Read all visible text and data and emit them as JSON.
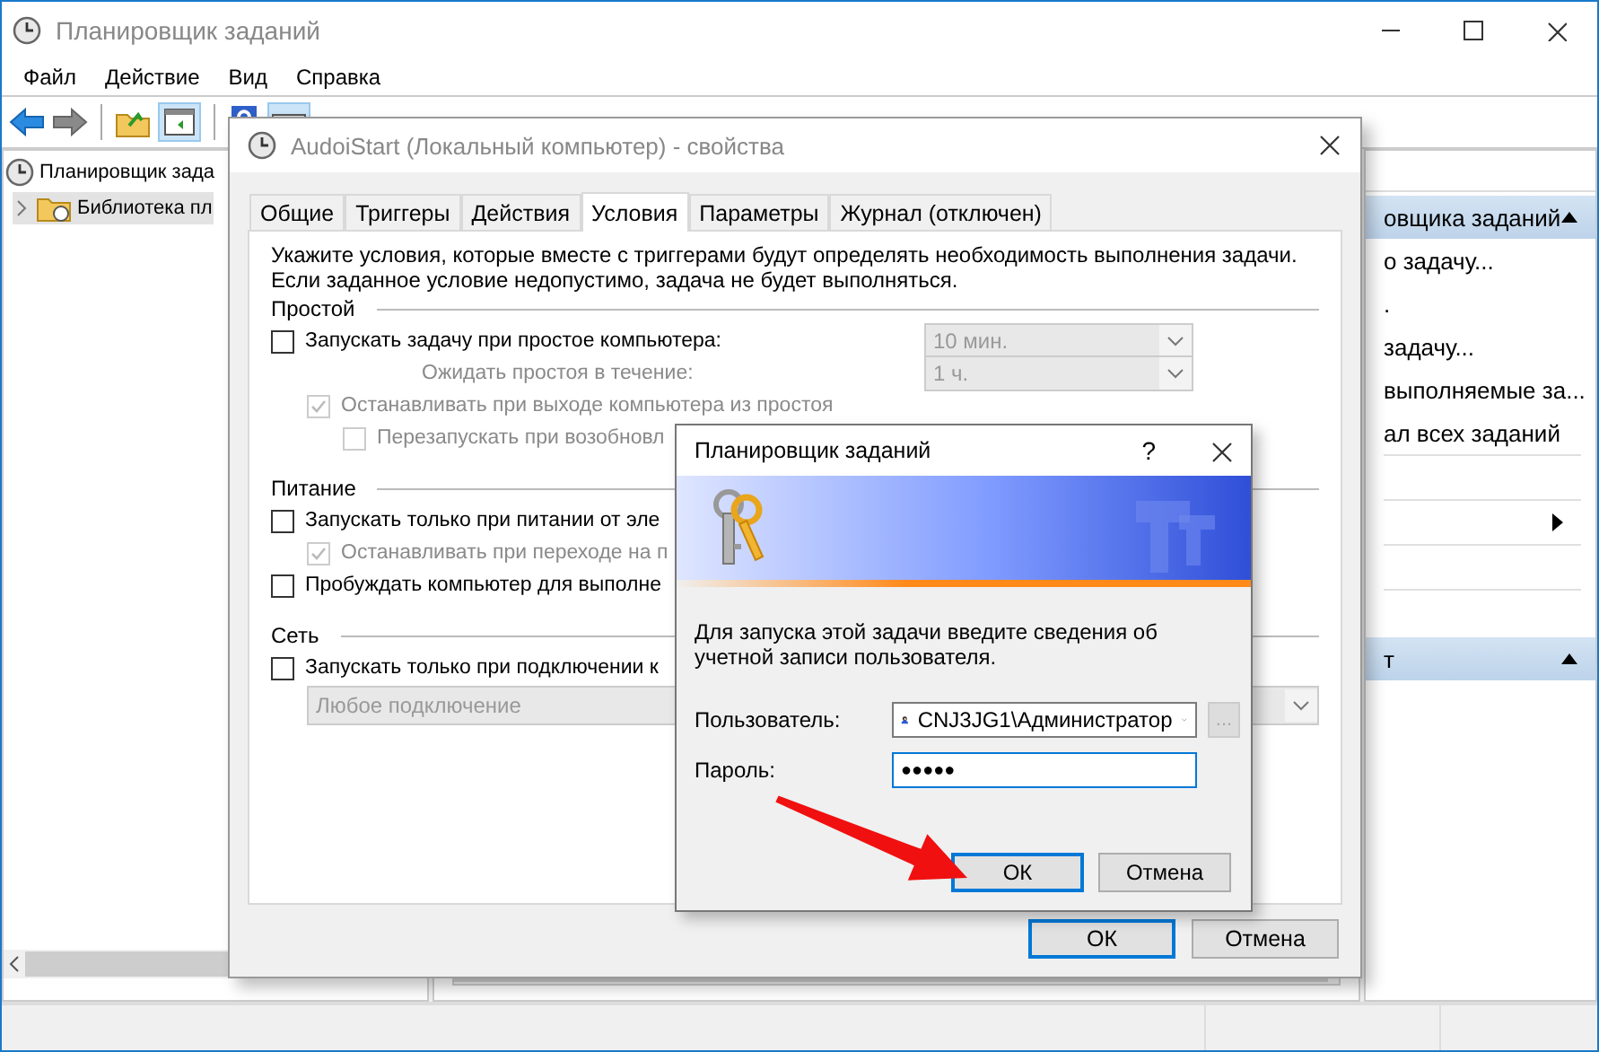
{
  "main_window": {
    "title": "Планировщик заданий",
    "menu": [
      "Файл",
      "Действие",
      "Вид",
      "Справка"
    ],
    "tree": [
      {
        "label": "Планировщик зада",
        "selected": false,
        "children": [
          {
            "label": "Библиотека пл",
            "selected": true,
            "expanded": false
          }
        ]
      }
    ],
    "actions_panel": {
      "sections": [
        {
          "title": "овщика заданий",
          "expanded": true,
          "items": [
            "о задачу...",
            ".",
            "задачу...",
            "выполняемые за...",
            "ал всех заданий"
          ]
        },
        {
          "title": "т",
          "expanded": true
        }
      ]
    }
  },
  "properties_dialog": {
    "title": "AudoiStart (Локальный компьютер) - свойства",
    "tabs": [
      {
        "label": "Общие",
        "selected": false
      },
      {
        "label": "Триггеры",
        "selected": false
      },
      {
        "label": "Действия",
        "selected": false
      },
      {
        "label": "Условия",
        "selected": true
      },
      {
        "label": "Параметры",
        "selected": false
      },
      {
        "label": "Журнал (отключен)",
        "selected": false
      }
    ],
    "intro": [
      "Укажите условия, которые вместе с триггерами будут определять необходимость выполнения задачи.",
      "Если заданное условие недопустимо, задача не будет выполняться."
    ],
    "sections": [
      {
        "title": "Простой",
        "options": [
          {
            "kind": "checkbox",
            "label": "Запускать задачу при простое компьютера:",
            "checked": false,
            "disabled": false,
            "dropdown": {
              "value": "10 мин.",
              "disabled": true
            },
            "children": [
              {
                "kind": "label",
                "label": "Ожидать простоя в течение:",
                "disabled": true,
                "dropdown": {
                  "value": "1 ч.",
                  "disabled": true
                }
              },
              {
                "kind": "checkbox",
                "label": "Останавливать при выходе компьютера из простоя",
                "checked": true,
                "disabled": true,
                "children": [
                  {
                    "kind": "checkbox",
                    "label": "Перезапускать при возобновл",
                    "checked": false,
                    "disabled": true
                  }
                ]
              }
            ]
          }
        ]
      },
      {
        "title": "Питание",
        "options": [
          {
            "kind": "checkbox",
            "label": "Запускать только при питании от эле",
            "checked": false,
            "disabled": false,
            "children": [
              {
                "kind": "checkbox",
                "label": "Останавливать при переходе на п",
                "checked": true,
                "disabled": true
              }
            ]
          },
          {
            "kind": "checkbox",
            "label": "Пробуждать компьютер для выполне",
            "checked": false,
            "disabled": false
          }
        ]
      },
      {
        "title": "Сеть",
        "options": [
          {
            "kind": "checkbox",
            "label": "Запускать только при подключении к",
            "checked": false,
            "disabled": false,
            "children": [
              {
                "kind": "dropdown",
                "value": "Любое подключение",
                "disabled": true
              }
            ]
          }
        ]
      }
    ],
    "buttons": [
      {
        "label": "ОК",
        "default": true
      },
      {
        "label": "Отмена",
        "default": false
      }
    ]
  },
  "credentials_dialog": {
    "title": "Планировщик заданий",
    "help_button": "?",
    "message": "Для запуска этой задачи введите сведения об учетной записи пользователя.",
    "user": {
      "label": "Пользователь:",
      "value": "CNJ3JG1\\Администратор"
    },
    "browse_button": "...",
    "password": {
      "label": "Пароль:",
      "value": "●●●●●"
    },
    "buttons": [
      {
        "label": "ОК",
        "default": true
      },
      {
        "label": "Отмена",
        "default": false
      }
    ]
  }
}
